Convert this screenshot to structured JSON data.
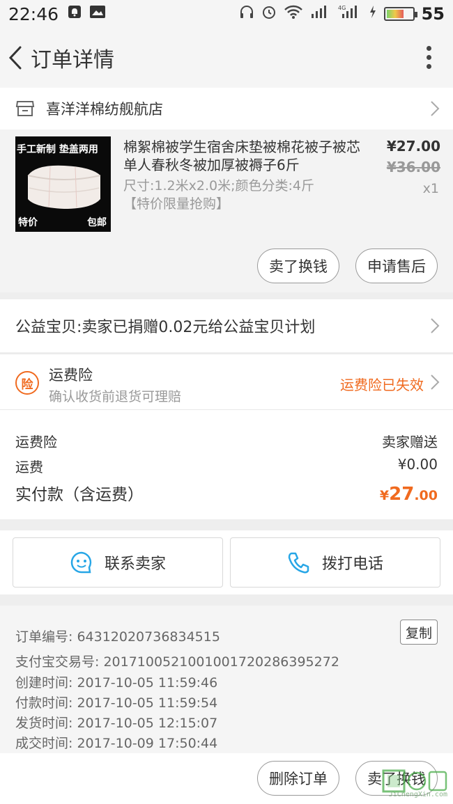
{
  "status_bar": {
    "time": "22:46",
    "battery_level": "55"
  },
  "header": {
    "title": "订单详情"
  },
  "store": {
    "name": "喜洋洋棉纺舰航店"
  },
  "product": {
    "image_tag_top": "手工新制 垫盖两用",
    "image_tag_bottom_left": "特价",
    "image_tag_bottom_right": "包邮",
    "title": "棉絮棉被学生宿舍床垫被棉花被子被芯单人春秋冬被加厚被褥子6斤",
    "spec": "尺寸:1.2米x2.0米;颜色分类:4斤",
    "promo": "【特价限量抢购】",
    "price": "¥27.00",
    "original_price": "¥36.00",
    "quantity": "x1",
    "sell_button": "卖了换钱",
    "after_sale_button": "申请售后"
  },
  "charity": {
    "text": "公益宝贝:卖家已捐赠0.02元给公益宝贝计划"
  },
  "insurance": {
    "icon_char": "险",
    "title": "运费险",
    "subtitle": "确认收货前退货可理赔",
    "status": "运费险已失效",
    "status_color": "#f06a1f"
  },
  "fees": {
    "shipping_insurance_label": "运费险",
    "shipping_insurance_value": "卖家赠送",
    "shipping_label": "运费",
    "shipping_value": "¥0.00",
    "total_label": "实付款（含运费）",
    "total_symbol": "¥",
    "total_int": "27",
    "total_dec": ".00"
  },
  "contact": {
    "seller_button": "联系卖家",
    "call_button": "拨打电话"
  },
  "order_info": {
    "order_no": "订单编号: 64312020736834515",
    "copy_button": "复制",
    "alipay_no": "支付宝交易号: 2017100521001001720286395272",
    "created": "创建时间: 2017-10-05 11:59:46",
    "paid": "付款时间: 2017-10-05 11:59:54",
    "shipped": "发货时间: 2017-10-05 12:15:07",
    "completed": "成交时间: 2017-10-09 17:50:44"
  },
  "bottom_bar": {
    "delete_button": "删除订单",
    "sell_button": "卖了换钱"
  },
  "watermark": {
    "text": "JiChengXin.com"
  }
}
